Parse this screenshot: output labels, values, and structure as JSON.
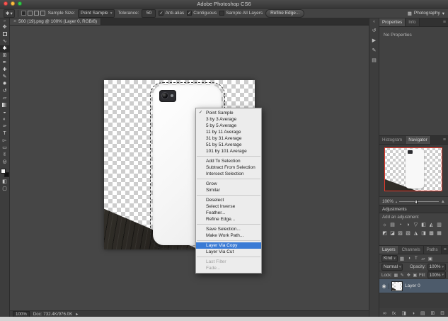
{
  "window": {
    "title": "Adobe Photoshop CS6"
  },
  "options_bar": {
    "tool_icon_glyph": "✱",
    "tool_arrow_glyph": "▾",
    "mode_icons": [
      "new-selection",
      "add-to-selection",
      "subtract-from-selection",
      "intersect-selection"
    ],
    "sample_size_label": "Sample Size:",
    "sample_size_value": "Point Sample",
    "dropdown_glyph": "▾",
    "tolerance_label": "Tolerance:",
    "tolerance_value": "50",
    "checkboxes": [
      {
        "label": "Anti-alias",
        "mark": "✓",
        "checked": true
      },
      {
        "label": "Contiguous",
        "mark": "✓",
        "checked": true
      },
      {
        "label": "Sample All Layers",
        "mark": "",
        "checked": false
      }
    ],
    "refine_edge_label": "Refine Edge...",
    "workspace_icon_glyph": "▦",
    "workspace": "Photography",
    "workspace_chevron": "▾"
  },
  "document_tab": {
    "close_glyph": "×",
    "title": "500 (19).png @ 100% (Layer 0, RGB/8)"
  },
  "toolbar": {
    "collapse_glyph": "»",
    "tools": [
      {
        "name": "move-tool",
        "glyph": "✥"
      },
      {
        "name": "rectangular-marquee-tool",
        "glyph": ""
      },
      {
        "name": "lasso-tool",
        "glyph": "∿"
      },
      {
        "name": "magic-wand-tool",
        "glyph": "✱",
        "active": true
      },
      {
        "name": "crop-tool",
        "glyph": "⊞"
      },
      {
        "name": "eyedropper-tool",
        "glyph": "✒"
      },
      {
        "name": "healing-brush-tool",
        "glyph": "✚"
      },
      {
        "name": "brush-tool",
        "glyph": "✎"
      },
      {
        "name": "clone-stamp-tool",
        "glyph": "✹"
      },
      {
        "name": "history-brush-tool",
        "glyph": "↺"
      },
      {
        "name": "eraser-tool",
        "glyph": "▱"
      },
      {
        "name": "gradient-tool",
        "glyph": ""
      },
      {
        "name": "blur-tool",
        "glyph": "◒"
      },
      {
        "name": "dodge-tool",
        "glyph": "◐"
      },
      {
        "name": "pen-tool",
        "glyph": "✑"
      },
      {
        "name": "type-tool",
        "glyph": "T"
      },
      {
        "name": "path-selection-tool",
        "glyph": "▻"
      },
      {
        "name": "shape-tool",
        "glyph": "▭"
      },
      {
        "name": "hand-tool",
        "glyph": "✌"
      },
      {
        "name": "zoom-tool",
        "glyph": "◎"
      }
    ],
    "extra": [
      {
        "name": "quick-mask-mode",
        "glyph": "◧"
      },
      {
        "name": "screen-mode",
        "glyph": "▢"
      }
    ]
  },
  "panel_strip": [
    {
      "name": "collapse-panels",
      "glyph": "«"
    },
    {
      "name": "history-panel",
      "glyph": "↺"
    },
    {
      "name": "actions-panel",
      "glyph": "▶"
    },
    {
      "name": "brush-panel",
      "glyph": "✎"
    },
    {
      "name": "clone-source-panel",
      "glyph": "▤"
    }
  ],
  "context_menu": {
    "check_glyph": "✓",
    "items": [
      {
        "label": "Point Sample",
        "checked": true
      },
      {
        "label": "3 by 3 Average"
      },
      {
        "label": "5 by 5 Average"
      },
      {
        "label": "11 by 11 Average"
      },
      {
        "label": "31 by 31 Average"
      },
      {
        "label": "51 by 51 Average"
      },
      {
        "label": "101 by 101 Average",
        "separator_after": true
      },
      {
        "label": "Add To Selection"
      },
      {
        "label": "Subtract From Selection"
      },
      {
        "label": "Intersect Selection",
        "separator_after": true
      },
      {
        "label": "Grow"
      },
      {
        "label": "Similar",
        "separator_after": true
      },
      {
        "label": "Deselect"
      },
      {
        "label": "Select Inverse"
      },
      {
        "label": "Feather..."
      },
      {
        "label": "Refine Edge...",
        "separator_after": true
      },
      {
        "label": "Save Selection..."
      },
      {
        "label": "Make Work Path...",
        "separator_after": true
      },
      {
        "label": "Layer Via Copy",
        "highlighted": true
      },
      {
        "label": "Layer Via Cut",
        "separator_after": true
      },
      {
        "label": "Last Filter",
        "disabled": true
      },
      {
        "label": "Fade...",
        "disabled": true
      }
    ]
  },
  "panels": {
    "menu_glyph": "≡",
    "properties": {
      "tab_properties": "Properties",
      "tab_info": "Info",
      "empty_text": "No Properties"
    },
    "navigator": {
      "tab_histogram": "Histogram",
      "tab_navigator": "Navigator",
      "zoom_value": "100%",
      "zoom_out_glyph": "▴",
      "zoom_in_glyph": "▲"
    },
    "adjustments": {
      "title": "Adjustments",
      "subtitle": "Add an adjustment",
      "icons": [
        {
          "name": "brightness-contrast",
          "glyph": "☼"
        },
        {
          "name": "levels",
          "glyph": "▤"
        },
        {
          "name": "curves",
          "glyph": "◔"
        },
        {
          "name": "exposure",
          "glyph": "◑"
        },
        {
          "name": "vibrance",
          "glyph": "▽"
        },
        {
          "name": "hue-saturation",
          "glyph": "◧"
        },
        {
          "name": "color-balance",
          "glyph": "◭"
        },
        {
          "name": "black-white",
          "glyph": "▥"
        },
        {
          "name": "photo-filter",
          "glyph": "◩"
        },
        {
          "name": "channel-mixer",
          "glyph": "◪"
        },
        {
          "name": "color-lookup",
          "glyph": "▨"
        },
        {
          "name": "invert",
          "glyph": "▧"
        },
        {
          "name": "posterize",
          "glyph": "◮"
        },
        {
          "name": "threshold",
          "glyph": "◨"
        },
        {
          "name": "gradient-map",
          "glyph": "▩"
        },
        {
          "name": "selective-color",
          "glyph": "▦"
        }
      ]
    },
    "layers": {
      "tab_layers": "Layers",
      "tab_channels": "Channels",
      "tab_paths": "Paths",
      "kind_label": "Kind",
      "kind_icons": [
        {
          "name": "filter-pixel-layers",
          "glyph": "▦"
        },
        {
          "name": "filter-adjustment-layers",
          "glyph": "◑"
        },
        {
          "name": "filter-type-layers",
          "glyph": "T"
        },
        {
          "name": "filter-shape-layers",
          "glyph": "▱"
        },
        {
          "name": "filter-smart-objects",
          "glyph": "▣"
        }
      ],
      "blend_mode": "Normal",
      "opacity_label": "Opacity:",
      "opacity_value": "100%",
      "lock_label": "Lock:",
      "lock_icons": [
        {
          "name": "lock-transparent-pixels",
          "glyph": "▦"
        },
        {
          "name": "lock-image-pixels",
          "glyph": "✎"
        },
        {
          "name": "lock-position",
          "glyph": "✥"
        },
        {
          "name": "lock-all",
          "glyph": "▣"
        }
      ],
      "fill_label": "Fill:",
      "fill_value": "100%",
      "eye_glyph": "◉",
      "layer_name": "Layer 0",
      "bottom_icons": [
        {
          "name": "link-layers",
          "glyph": "∞"
        },
        {
          "name": "layer-styles",
          "glyph": "fx"
        },
        {
          "name": "layer-mask",
          "glyph": "◨"
        },
        {
          "name": "adjustment-layer",
          "glyph": "◑"
        },
        {
          "name": "layer-group",
          "glyph": "▤"
        },
        {
          "name": "new-layer",
          "glyph": "⊞"
        },
        {
          "name": "delete-layer",
          "glyph": "⊟"
        }
      ]
    }
  },
  "status_bar": {
    "zoom": "100%",
    "doc_info": "Doc: 732.4K/976.0K",
    "arrow_glyph": "▸"
  },
  "colors": {
    "menu_highlight": "#3a7bd5",
    "navigator_view_box": "#e8392b",
    "selected_layer_row": "#4d5b6b",
    "traffic_close": "#fc5652",
    "traffic_minimize": "#fdbe41",
    "traffic_zoom": "#34c84a"
  }
}
